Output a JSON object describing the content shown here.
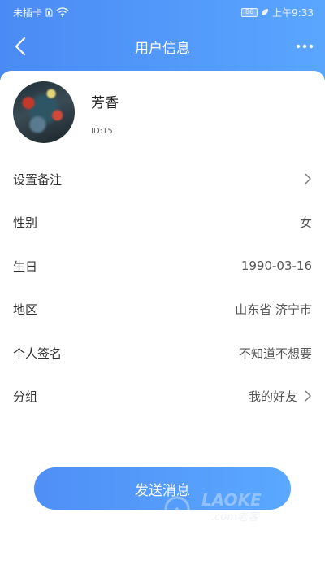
{
  "status_bar": {
    "carrier": "未插卡",
    "battery": "86",
    "time": "上午9:33"
  },
  "nav": {
    "title": "用户信息"
  },
  "profile": {
    "name": "芳香",
    "id_text": "ID:15"
  },
  "rows": [
    {
      "label": "设置备注",
      "value": "",
      "chevron": true
    },
    {
      "label": "性别",
      "value": "女",
      "chevron": false
    },
    {
      "label": "生日",
      "value": "1990-03-16",
      "chevron": false
    },
    {
      "label": "地区",
      "value": "山东省 济宁市",
      "chevron": false
    },
    {
      "label": "个人签名",
      "value": "不知道不想要",
      "chevron": false
    },
    {
      "label": "分组",
      "value": "我的好友",
      "chevron": true
    }
  ],
  "send_button": {
    "label": "发送消息"
  },
  "watermark": {
    "text": "LAOKE",
    "subtext": ".com老客"
  },
  "colors": {
    "primary": "#4a8af4",
    "primary_light": "#5aa6ff"
  }
}
